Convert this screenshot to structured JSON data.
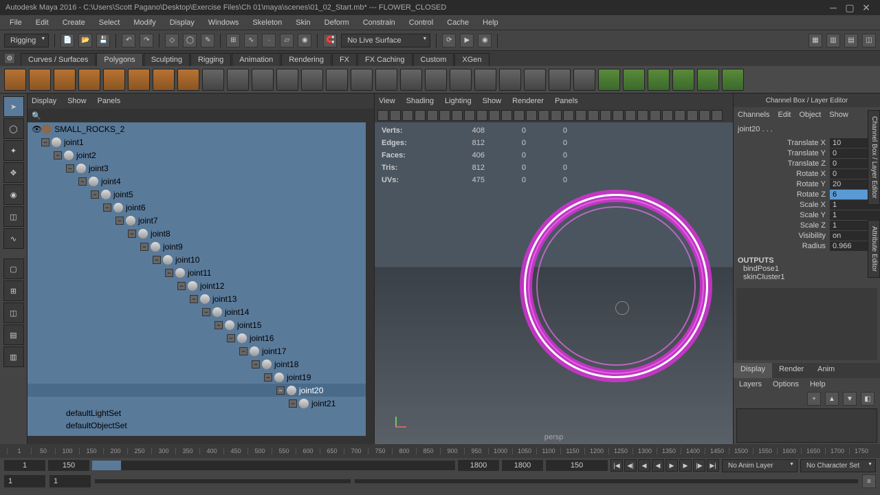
{
  "title": "Autodesk Maya 2016 - C:\\Users\\Scott Pagano\\Desktop\\Exercise Files\\Ch 01\\maya\\scenes\\01_02_Start.mb*  ---  FLOWER_CLOSED",
  "menu": [
    "File",
    "Edit",
    "Create",
    "Select",
    "Modify",
    "Display",
    "Windows",
    "Skeleton",
    "Skin",
    "Deform",
    "Constrain",
    "Control",
    "Cache",
    "Help"
  ],
  "workspace": "Rigging",
  "live_surface": "No Live Surface",
  "shelf_tabs": [
    "Curves / Surfaces",
    "Polygons",
    "Sculpting",
    "Rigging",
    "Animation",
    "Rendering",
    "FX",
    "FX Caching",
    "Custom",
    "XGen"
  ],
  "shelf_active": 1,
  "outliner": {
    "menu": [
      "Display",
      "Show",
      "Panels"
    ],
    "root_node": "SMALL_ROCKS_2",
    "joints": [
      "joint1",
      "joint2",
      "joint3",
      "joint4",
      "joint5",
      "joint6",
      "joint7",
      "joint8",
      "joint9",
      "joint10",
      "joint11",
      "joint12",
      "joint13",
      "joint14",
      "joint15",
      "joint16",
      "joint17",
      "joint18",
      "joint19",
      "joint20",
      "joint21"
    ],
    "selected": "joint20",
    "sets": [
      "defaultLightSet",
      "defaultObjectSet"
    ]
  },
  "viewport": {
    "menu": [
      "View",
      "Shading",
      "Lighting",
      "Show",
      "Renderer",
      "Panels"
    ],
    "camera": "persp",
    "hud": {
      "rows": [
        {
          "label": "Verts:",
          "a": "408",
          "b": "0",
          "c": "0"
        },
        {
          "label": "Edges:",
          "a": "812",
          "b": "0",
          "c": "0"
        },
        {
          "label": "Faces:",
          "a": "406",
          "b": "0",
          "c": "0"
        },
        {
          "label": "Tris:",
          "a": "812",
          "b": "0",
          "c": "0"
        },
        {
          "label": "UVs:",
          "a": "475",
          "b": "0",
          "c": "0"
        }
      ]
    }
  },
  "channel_box": {
    "title": "Channel Box / Layer Editor",
    "menu": [
      "Channels",
      "Edit",
      "Object",
      "Show"
    ],
    "object": "joint20 . . .",
    "attrs": [
      {
        "label": "Translate X",
        "val": "10"
      },
      {
        "label": "Translate Y",
        "val": "0"
      },
      {
        "label": "Translate Z",
        "val": "0"
      },
      {
        "label": "Rotate X",
        "val": "0"
      },
      {
        "label": "Rotate Y",
        "val": "20"
      },
      {
        "label": "Rotate Z",
        "val": "6",
        "hi": true
      },
      {
        "label": "Scale X",
        "val": "1"
      },
      {
        "label": "Scale Y",
        "val": "1"
      },
      {
        "label": "Scale Z",
        "val": "1"
      },
      {
        "label": "Visibility",
        "val": "on"
      },
      {
        "label": "Radius",
        "val": "0.966"
      }
    ],
    "outputs_label": "OUTPUTS",
    "outputs": [
      "bindPose1",
      "skinCluster1"
    ],
    "display_tabs": [
      "Display",
      "Render",
      "Anim"
    ],
    "layers_menu": [
      "Layers",
      "Options",
      "Help"
    ]
  },
  "side_tabs": [
    "Channel Box / Layer Editor",
    "Attribute Editor"
  ],
  "timeline": {
    "ticks": [
      "1",
      "50",
      "100",
      "150",
      "200",
      "250",
      "300",
      "350",
      "400",
      "450",
      "500",
      "550",
      "600",
      "650",
      "700",
      "750",
      "800",
      "850",
      "900",
      "950",
      "1000",
      "1050",
      "1100",
      "1150",
      "1200",
      "1250",
      "1300",
      "1350",
      "1400",
      "1450",
      "1500",
      "1550",
      "1600",
      "1650",
      "1700",
      "1750"
    ],
    "current": "150",
    "range_start": "1",
    "range_end": "1800",
    "anim_start": "1",
    "anim_end": "1800",
    "no_anim_layer": "No Anim Layer",
    "no_char_set": "No Character Set"
  },
  "cmdline": {
    "a": "1",
    "b": "1"
  }
}
